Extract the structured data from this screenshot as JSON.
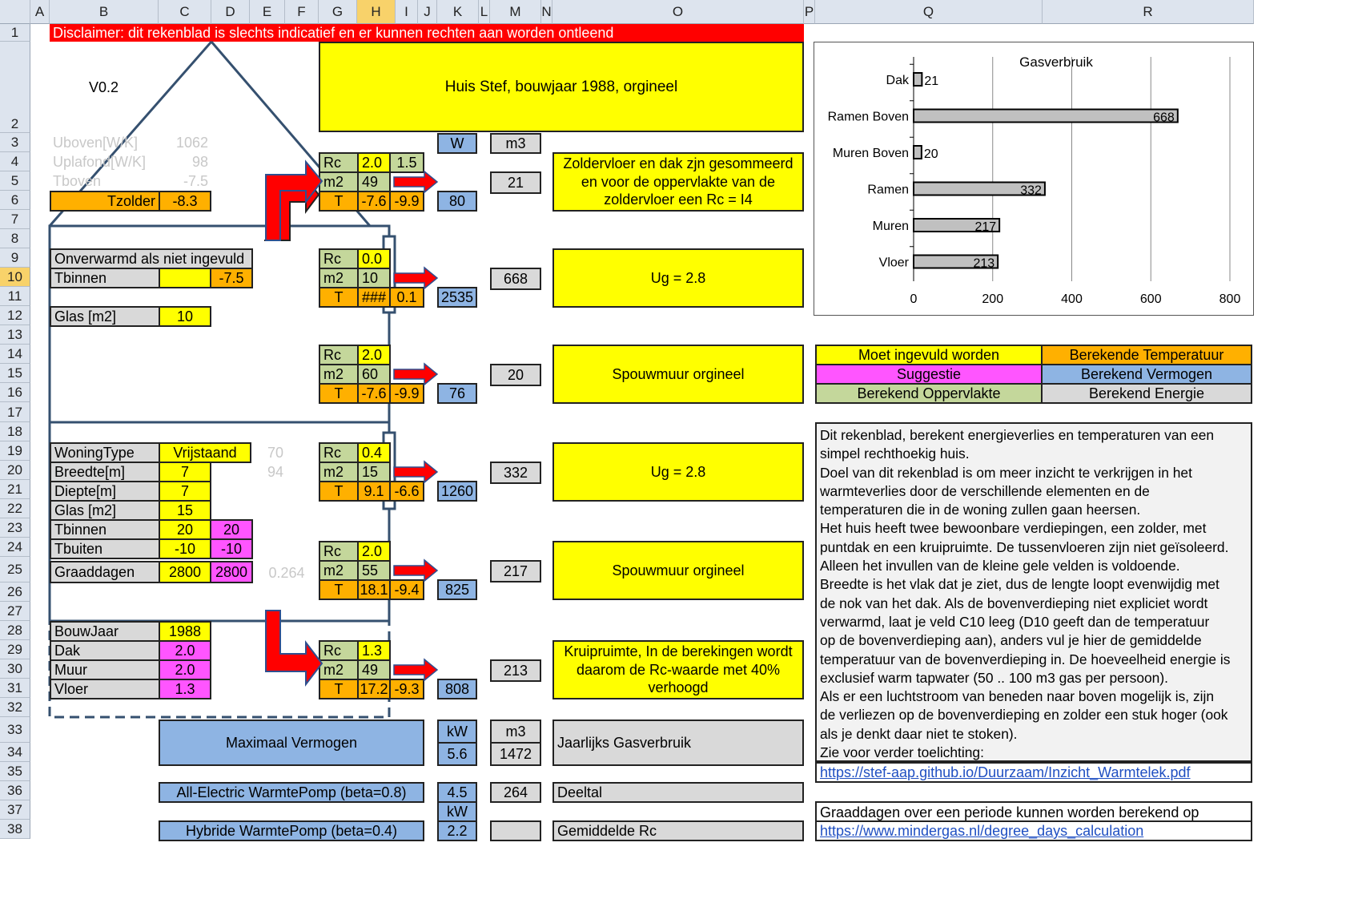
{
  "cols": [
    "",
    "A",
    "B",
    "C",
    "D",
    "E",
    "F",
    "G",
    "H",
    "I",
    "J",
    "K",
    "L",
    "M",
    "N",
    "O",
    "P",
    "Q",
    "R"
  ],
  "rows": [
    "1",
    "2",
    "3",
    "4",
    "5",
    "6",
    "7",
    "8",
    "9",
    "10",
    "11",
    "12",
    "13",
    "14",
    "15",
    "16",
    "17",
    "18",
    "19",
    "20",
    "21",
    "22",
    "23",
    "24",
    "25",
    "26",
    "27",
    "28",
    "29",
    "30",
    "31",
    "32",
    "33",
    "34",
    "35",
    "36",
    "37",
    "38"
  ],
  "disclaimer": "Disclaimer: dit rekenblad is slechts indicatief en er kunnen rechten aan worden ontleend",
  "version": "V0.2",
  "title": "Huis Stef, bouwjaar 1988, orgineel",
  "hdr": {
    "W": "W",
    "m3": "m3",
    "kW": "kW"
  },
  "upper": {
    "uboven_label": "Uboven[W/K]",
    "uboven": "1062",
    "uplafond_label": "Uplafond[W/K]",
    "uplafond": "98",
    "tboven_label": "Tboven",
    "tboven": "-7.5",
    "tzolder_label": "Tzolder",
    "tzolder": "-8.3"
  },
  "floor2": {
    "onverwarmd": "Onverwarmd als niet ingevuld",
    "tbinnen_label": "Tbinnen",
    "tbinnen": "-7.5",
    "glas_label": "Glas [m2]",
    "glas": "10"
  },
  "inputs": {
    "woningtype_label": "WoningType",
    "woningtype": "Vrijstaand",
    "woningtype_extra": "70",
    "breedte_label": "Breedte[m]",
    "breedte": "7",
    "breedte_extra": "94",
    "diepte_label": "Diepte[m]",
    "diepte": "7",
    "glas_label": "Glas [m2]",
    "glas": "15",
    "tbinnen_label": "Tbinnen",
    "tbinnen": "20",
    "tbinnen_s": "20",
    "tbuiten_label": "Tbuiten",
    "tbuiten": "-10",
    "tbuiten_s": "-10",
    "graad_label": "Graaddagen",
    "graad": "2800",
    "graad_s": "2800",
    "graad_extra": "0.264",
    "bouwjaar_label": "BouwJaar",
    "bouwjaar": "1988",
    "dak_label": "Dak",
    "dak": "2.0",
    "muur_label": "Muur",
    "muur": "2.0",
    "vloer_label": "Vloer",
    "vloer": "1.3"
  },
  "blocks": [
    {
      "rc": "2.0",
      "rc2": "1.5",
      "m2": "49",
      "t1": "-7.6",
      "t2": "-9.9",
      "w": "80",
      "m3": "21"
    },
    {
      "rc": "0.0",
      "m2": "10",
      "t1": "###",
      "t2": "0.1",
      "w": "2535",
      "m3": "668"
    },
    {
      "rc": "2.0",
      "m2": "60",
      "t1": "-7.6",
      "t2": "-9.9",
      "w": "76",
      "m3": "20"
    },
    {
      "rc": "0.4",
      "m2": "15",
      "t1": "9.1",
      "t2": "-6.6",
      "w": "1260",
      "m3": "332"
    },
    {
      "rc": "2.0",
      "m2": "55",
      "t1": "18.1",
      "t2": "-9.4",
      "w": "825",
      "m3": "217"
    },
    {
      "rc": "1.3",
      "m2": "49",
      "t1": "17.2",
      "t2": "-9.3",
      "w": "808",
      "m3": "213"
    }
  ],
  "labels": {
    "rc": "Rc",
    "m2": "m2",
    "t": "T"
  },
  "notes": [
    "Zoldervloer en dak zjn gesommeerd en voor de oppervlakte van de zoldervloer een Rc = I4",
    "Ug = 2.8",
    "Spouwmuur orgineel",
    "Ug = 2.8",
    "Spouwmuur orgineel",
    "Kruipruimte, In de berekingen wordt daarom de Rc-waarde met 40% verhoogd"
  ],
  "totals": {
    "max_label": "Maximaal Vermogen",
    "kw": "kW",
    "kw_val": "5.6",
    "m3": "m3",
    "m3_val": "1472",
    "gas_label": "Jaarlijks Gasverbruik",
    "ae_label": "All-Electric WarmtePomp (beta=0.8)",
    "ae_kw": "4.5",
    "ae_m3": "264",
    "deeltal_label": "Deeltal",
    "kw2": "kW",
    "hy_label": "Hybride WarmtePomp (beta=0.4)",
    "hy_kw": "2.2",
    "rc_label": "Gemiddelde Rc"
  },
  "legend": {
    "yellow": "Moet ingevuld worden",
    "orange": "Berekende Temperatuur",
    "pink": "Suggestie",
    "blue": "Berekend Vermogen",
    "green": "Berekend Oppervlakte",
    "gray": "Berekend Energie"
  },
  "legend_colors": {
    "yellow": "#ffff00",
    "orange": "#ffb000",
    "pink": "#ff55ff",
    "blue": "#8eb4e3",
    "green": "#c4d79b",
    "gray": "#d9d9d9"
  },
  "description": [
    "Dit rekenblad, berekent energieverlies en temperaturen van een",
    "simpel rechthoekig huis.",
    "Doel van dit rekenblad is om meer inzicht te verkrijgen in het",
    "warmteverlies door de verschillende elementen en de",
    "temperaturen die in de woning zullen gaan heersen.",
    "Het huis heeft twee bewoonbare verdiepingen, een zolder, met",
    "puntdak en een kruipruimte. De tussenvloeren zijn niet geïsoleerd.",
    "Alleen het invullen van de kleine gele velden is voldoende.",
    "Breedte is het vlak dat je ziet, dus de lengte loopt evenwijdig met",
    "de nok van het dak. Als de bovenverdieping niet expliciet wordt",
    "verwarmd, laat je veld C10 leeg (D10 geeft dan de temperatuur",
    "op de bovenverdieping aan), anders vul je hier de gemiddelde",
    "temperatuur van de bovenverdieping in. De hoeveelheid energie is",
    "exclusief warm tapwater (50 .. 100 m3 gas per persoon).",
    "Als er een luchtstroom van beneden naar boven mogelijk is, zijn",
    "de verliezen op de bovenverdieping en zolder een stuk hoger (ook",
    "als je denkt daar niet te stoken).",
    "Zie voor verder toelichting:"
  ],
  "link1": "https://stef-aap.github.io/Duurzaam/Inzicht_Warmtelek.pdf",
  "graad_text": "Graaddagen over een periode kunnen worden berekend op",
  "link2": "https://www.mindergas.nl/degree_days_calculation",
  "chart_data": {
    "type": "bar",
    "title": "Gasverbruik",
    "categories": [
      "Dak",
      "Ramen Boven",
      "Muren Boven",
      "Ramen",
      "Muren",
      "Vloer"
    ],
    "values": [
      21,
      668,
      20,
      332,
      217,
      213
    ],
    "xlim": [
      0,
      800
    ],
    "xticks": [
      0,
      200,
      400,
      600,
      800
    ],
    "grid": true,
    "bar_color": "#c0c0c0"
  }
}
